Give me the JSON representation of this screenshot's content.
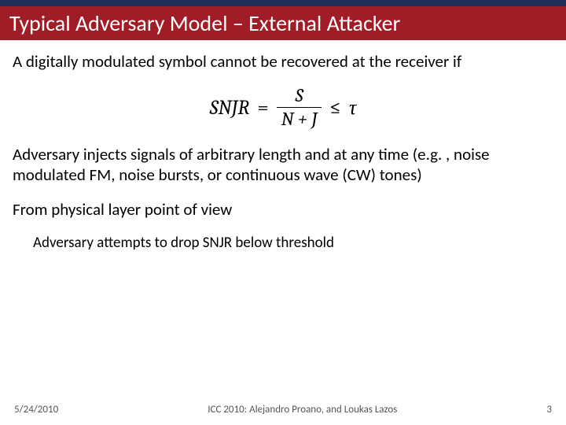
{
  "header": {
    "title": "Typical Adversary Model – External Attacker"
  },
  "body": {
    "intro": "A digitally modulated symbol cannot be recovered at the receiver if",
    "formula": {
      "lhs": "SNJR",
      "eq": "=",
      "num": "S",
      "den": "N + J",
      "rel": "≤",
      "rhs": "τ"
    },
    "adversary_text": "Adversary injects signals of arbitrary length and at any time (e.g. , noise modulated FM, noise bursts, or continuous wave (CW) tones)",
    "physical_heading": "From physical layer point of view",
    "physical_sub": "Adversary attempts to drop SNJR below threshold"
  },
  "footer": {
    "date": "5/24/2010",
    "center": "ICC 2010:  Alejandro Proano, and Loukas Lazos",
    "page": "3"
  }
}
